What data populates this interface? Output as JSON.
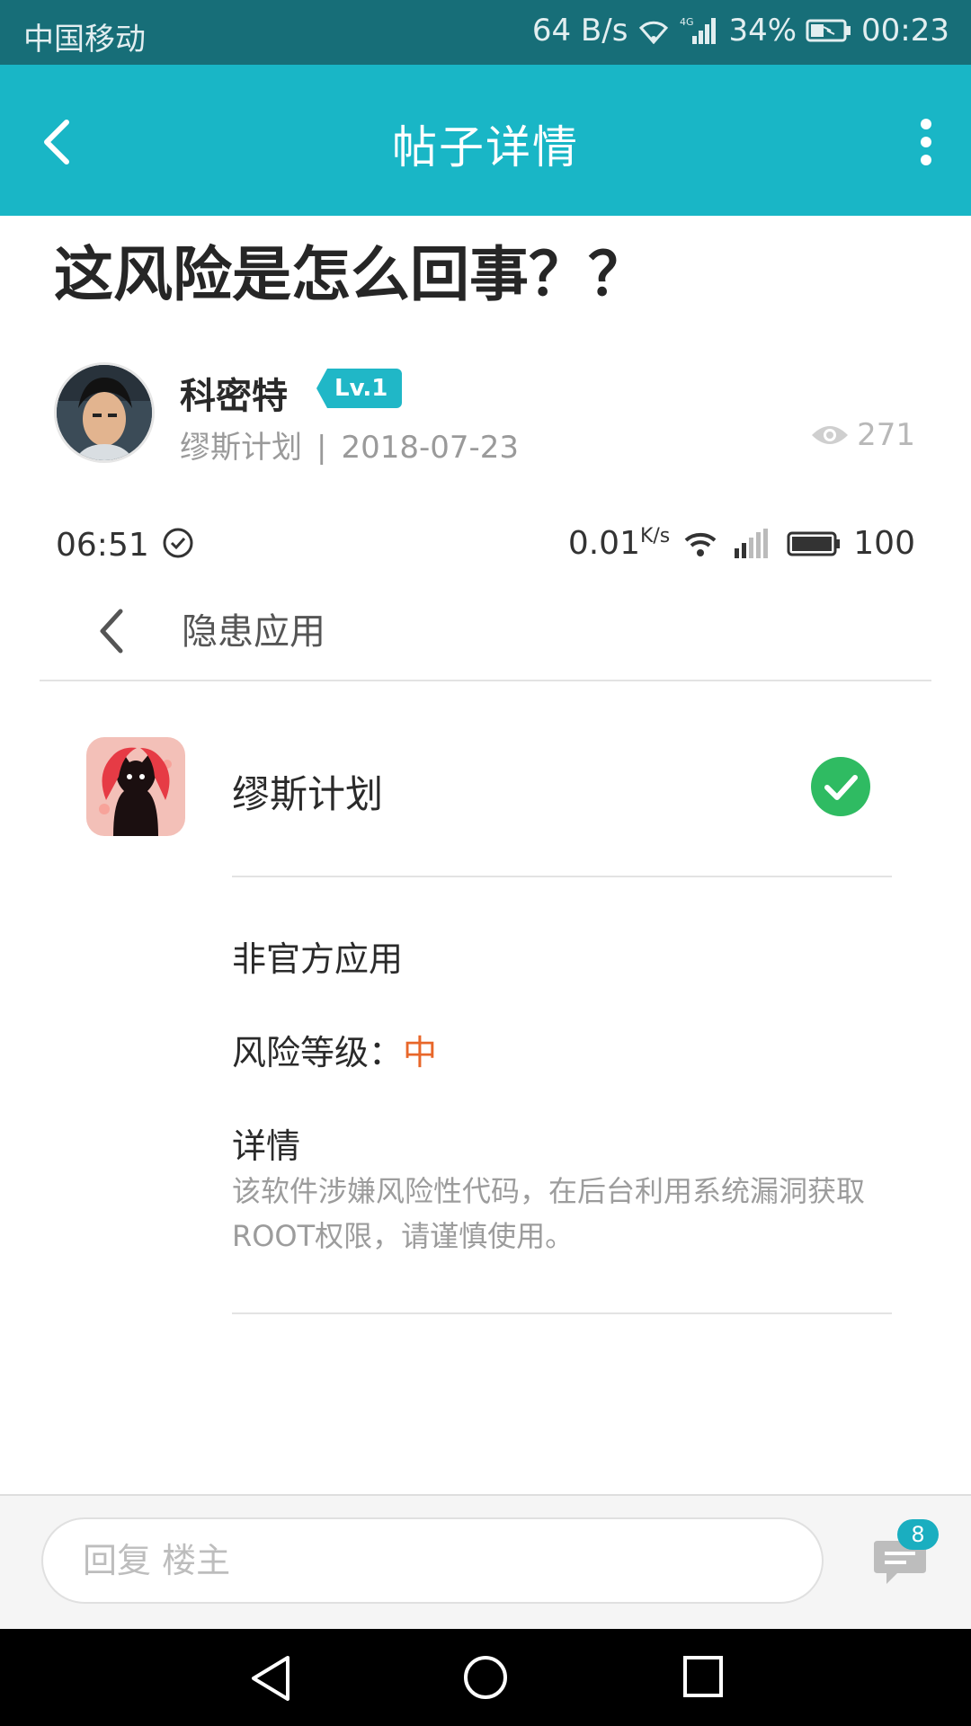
{
  "status_bar": {
    "carrier": "中国移动",
    "speed": "64 B/s",
    "network": "4G",
    "battery": "34%",
    "time": "00:23"
  },
  "header": {
    "title": "帖子详情"
  },
  "post": {
    "title": "这风险是怎么回事？？",
    "author": "科密特",
    "level": "Lv.1",
    "source": "缪斯计划",
    "separator": "|",
    "date": "2018-07-23",
    "views": "271"
  },
  "screenshot": {
    "status": {
      "time": "06:51",
      "speed": "0.01",
      "speed_unit": "K/s",
      "battery": "100"
    },
    "page_title": "隐患应用",
    "app": {
      "name": "缪斯计划",
      "type": "非官方应用",
      "risk_label": "风险等级：",
      "risk_level": "中",
      "risk_color": "#e8672a",
      "detail_heading": "详情",
      "detail_text": "该软件涉嫌风险性代码，在后台利用系统漏洞获取ROOT权限，请谨慎使用。"
    }
  },
  "reply_bar": {
    "placeholder": "回复  楼主",
    "comment_count": "8"
  },
  "colors": {
    "status_bar": "#176e78",
    "header": "#19b6c6",
    "badge": "#1aaec0",
    "check": "#2fbb62"
  },
  "icons": [
    "back-icon",
    "more-icon",
    "eye-icon",
    "check-icon",
    "comment-icon",
    "nav-back-icon",
    "nav-home-icon",
    "nav-recents-icon"
  ]
}
